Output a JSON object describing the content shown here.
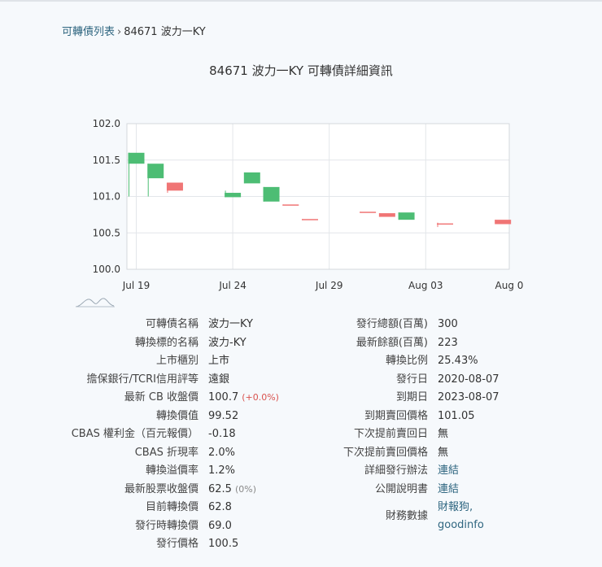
{
  "breadcrumb": {
    "list_link": "可轉債列表",
    "separator": "›",
    "current": "84671 波力一KY"
  },
  "title": "84671 波力一KY 可轉債詳細資訊",
  "chart_data": {
    "type": "candlestick",
    "xlabels": [
      "Jul 19",
      "Jul 24",
      "Jul 29",
      "Aug 03",
      "Aug 0"
    ],
    "ylim": [
      100.0,
      102.0
    ],
    "yticks": [
      "100.0",
      "100.5",
      "101.0",
      "101.5",
      "102.0"
    ],
    "up_color": "#f07575",
    "down_color": "#4dbd74",
    "candles": [
      {
        "day": 0,
        "open": 101.6,
        "close": 101.45,
        "high": 101.6,
        "low": 101.0
      },
      {
        "day": 1,
        "open": 101.45,
        "close": 101.25,
        "high": 101.45,
        "low": 101.0
      },
      {
        "day": 2,
        "open": 101.08,
        "close": 101.19,
        "high": 101.19,
        "low": 101.05
      },
      {
        "day": 5,
        "open": 101.05,
        "close": 100.99,
        "high": 101.08,
        "low": 100.99
      },
      {
        "day": 6,
        "open": 101.33,
        "close": 101.18,
        "high": 101.33,
        "low": 101.18
      },
      {
        "day": 7,
        "open": 101.13,
        "close": 100.93,
        "high": 101.13,
        "low": 100.93
      },
      {
        "day": 8,
        "open": 100.88,
        "close": 100.89,
        "high": 100.89,
        "low": 100.88
      },
      {
        "day": 9,
        "open": 100.68,
        "close": 100.69,
        "high": 100.69,
        "low": 100.68
      },
      {
        "day": 12,
        "open": 100.78,
        "close": 100.79,
        "high": 100.79,
        "low": 100.78
      },
      {
        "day": 13,
        "open": 100.72,
        "close": 100.77,
        "high": 100.77,
        "low": 100.72
      },
      {
        "day": 14,
        "open": 100.78,
        "close": 100.68,
        "high": 100.78,
        "low": 100.68
      },
      {
        "day": 16,
        "open": 100.62,
        "close": 100.63,
        "high": 100.64,
        "low": 100.58
      },
      {
        "day": 19,
        "open": 100.62,
        "close": 100.68,
        "high": 100.68,
        "low": 100.62
      }
    ]
  },
  "left_table": [
    {
      "k": "可轉債名稱",
      "v": "波力一KY"
    },
    {
      "k": "轉換標的名稱",
      "v": "波力-KY"
    },
    {
      "k": "上市櫃別",
      "v": "上市"
    },
    {
      "k": "擔保銀行/TCRI信用評等",
      "v": "遠銀"
    },
    {
      "k": "最新 CB 收盤價",
      "v": "100.7",
      "extra": "(+0.0%)",
      "extra_class": "chg"
    },
    {
      "k": "轉換價值",
      "v": "99.52"
    },
    {
      "k": "CBAS 權利金（百元報價）",
      "v": "-0.18"
    },
    {
      "k": "CBAS 折現率",
      "v": "2.0%"
    },
    {
      "k": "轉換溢價率",
      "v": "1.2%"
    },
    {
      "k": "最新股票收盤價",
      "v": "62.5",
      "extra": "(0%)",
      "extra_class": "grey"
    },
    {
      "k": "目前轉換價",
      "v": "62.8"
    },
    {
      "k": "發行時轉換價",
      "v": "69.0"
    },
    {
      "k": "發行價格",
      "v": "100.5"
    }
  ],
  "right_table": [
    {
      "k": "發行總額(百萬)",
      "v": "300"
    },
    {
      "k": "最新餘額(百萬)",
      "v": "223"
    },
    {
      "k": "轉換比例",
      "v": "25.43%"
    },
    {
      "k": "發行日",
      "v": "2020-08-07"
    },
    {
      "k": "到期日",
      "v": "2023-08-07"
    },
    {
      "k": "到期賣回價格",
      "v": "101.05"
    },
    {
      "k": "下次提前賣回日",
      "v": "無"
    },
    {
      "k": "下次提前賣回價格",
      "v": "無"
    },
    {
      "k": "詳細發行辦法",
      "v": "連結",
      "link": true
    },
    {
      "k": "公開說明書",
      "v": "連結",
      "link": true
    }
  ],
  "finance": {
    "k": "財務數據",
    "link1": "財報狗,",
    "link2": "goodinfo"
  }
}
